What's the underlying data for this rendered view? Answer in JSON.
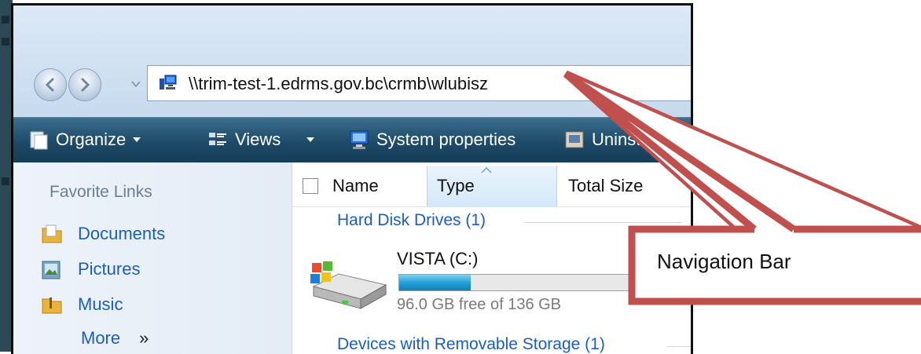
{
  "address_bar": {
    "path": "\\\\trim-test-1.edrms.gov.bc\\crmb\\wlubisz"
  },
  "toolbar": {
    "items": [
      {
        "label": "Organize",
        "icon": "organize-icon"
      },
      {
        "label": "Views",
        "icon": "views-icon"
      },
      {
        "label": "System properties",
        "icon": "system-properties-icon"
      },
      {
        "label": "Uninstall o",
        "icon": "uninstall-icon"
      }
    ]
  },
  "favorites": {
    "title": "Favorite Links",
    "items": [
      {
        "label": "Documents",
        "icon": "documents-folder-icon"
      },
      {
        "label": "Pictures",
        "icon": "pictures-folder-icon"
      },
      {
        "label": "Music",
        "icon": "music-folder-icon"
      },
      {
        "label": "More",
        "icon": "more-chevrons-icon"
      }
    ]
  },
  "columns": {
    "name": "Name",
    "type": "Type",
    "total_size": "Total Size"
  },
  "groups": {
    "hard_disk": "Hard Disk Drives (1)",
    "removable": "Devices with Removable Storage (1)"
  },
  "drive": {
    "name": "VISTA (C:)",
    "free_text": "96.0 GB free of 136 GB",
    "used_fraction": 0.294
  },
  "callout": {
    "label": "Navigation Bar"
  },
  "colors": {
    "callout_stroke": "#c0504d",
    "link_blue": "#1c5ebd",
    "toolbar_dark": "#1d4a68"
  }
}
